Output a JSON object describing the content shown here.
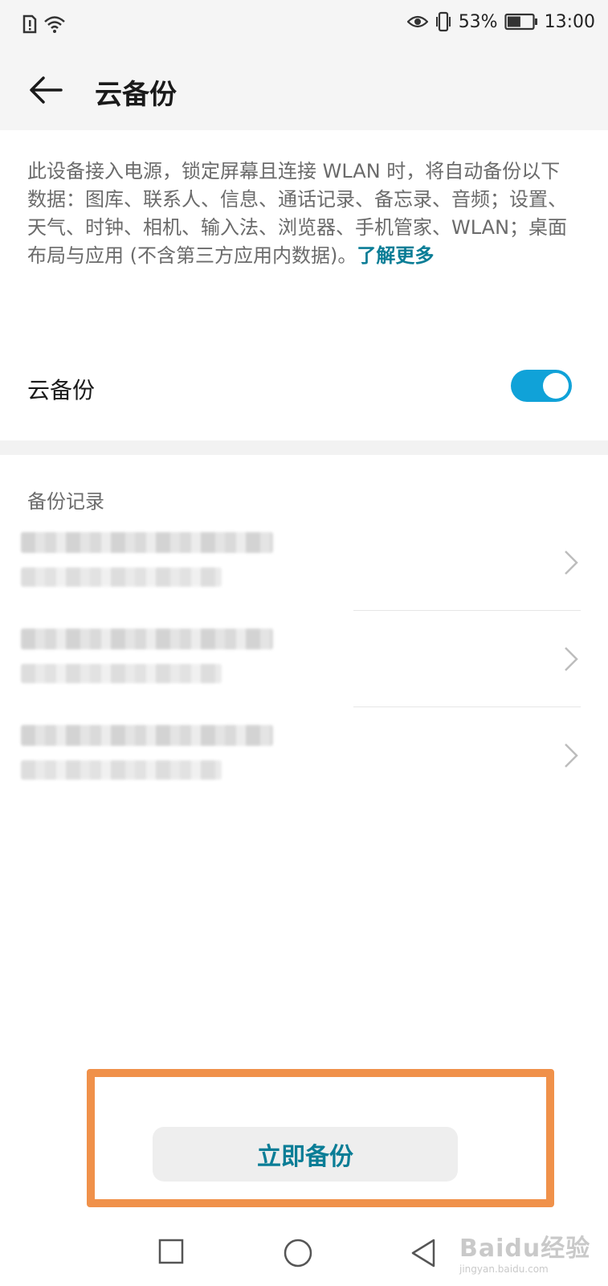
{
  "status_bar": {
    "battery_percent": "53%",
    "battery_level": 0.53,
    "time": "13:00",
    "icons": [
      "sim-alert-icon",
      "wifi-icon",
      "eye-comfort-icon",
      "vibrate-icon",
      "battery-icon"
    ]
  },
  "header": {
    "title": "云备份",
    "back_icon": "arrow-left-icon"
  },
  "description": {
    "text": "此设备接入电源，锁定屏幕且连接 WLAN 时，将自动备份以下数据：图库、联系人、信息、通话记录、备忘录、音频；设置、天气、时钟、相机、输入法、浏览器、手机管家、WLAN；桌面布局与应用 (不含第三方应用内数据)。",
    "link": "了解更多"
  },
  "cloud_backup_toggle": {
    "label": "云备份",
    "on": true,
    "accent": "#10a2d8"
  },
  "records_section": {
    "title": "备份记录",
    "item_count_blurred": 3
  },
  "primary_action": {
    "label": "立即备份",
    "color": "#0a7d96"
  },
  "highlight_color": "#f0914a",
  "navigation_bar": {
    "icons": [
      "recents-square-icon",
      "home-circle-icon",
      "back-triangle-icon"
    ]
  },
  "watermark": {
    "logo": "Baidu经验",
    "url": "jingyan.baidu.com"
  }
}
